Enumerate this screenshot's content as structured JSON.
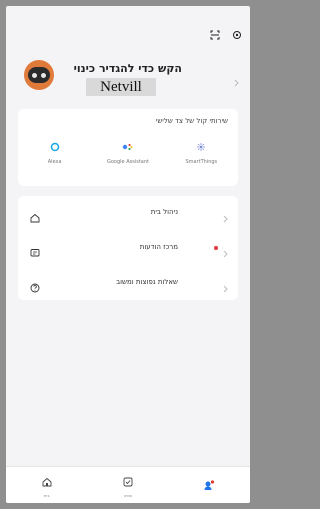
{
  "topbar": {
    "icons": [
      "scan-icon",
      "settings-icon"
    ]
  },
  "profile": {
    "prompt": "הקש כדי להגדיר כינוי",
    "brand": "Netvill"
  },
  "voice_services": {
    "title": "שירותי קול של צד שלישי",
    "items": [
      {
        "label": "Alexa",
        "icon": "alexa-icon",
        "color": "#19a7e8"
      },
      {
        "label": "Google Assistant",
        "icon": "google-assistant-icon",
        "color": "#4285f4"
      },
      {
        "label": "SmartThings",
        "icon": "smartthings-icon",
        "color": "#7b8bd8"
      }
    ]
  },
  "menu": {
    "items": [
      {
        "label": "ניהול בית",
        "icon": "home-icon"
      },
      {
        "label": "מרכז הודעות",
        "icon": "message-icon",
        "has_badge": true
      },
      {
        "label": "שאלות נפוצות ומשוב",
        "icon": "help-icon"
      }
    ]
  },
  "tabbar": {
    "items": [
      {
        "label": "בית",
        "icon": "home-tab-icon"
      },
      {
        "label": "שוויה",
        "icon": "scene-tab-icon"
      },
      {
        "label": "",
        "icon": "me-tab-icon",
        "active": true
      }
    ],
    "accent": "#1f73e8"
  }
}
